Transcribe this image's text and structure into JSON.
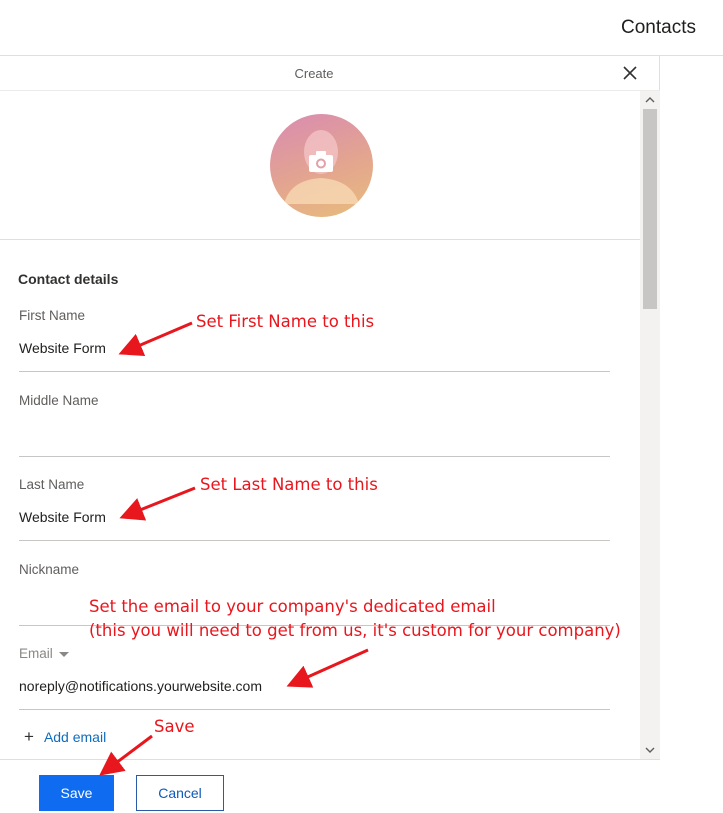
{
  "app": {
    "title": "Contacts"
  },
  "panel": {
    "title": "Create"
  },
  "section": {
    "title": "Contact details"
  },
  "fields": {
    "first_name": {
      "label": "First Name",
      "value": "Website Form"
    },
    "middle_name": {
      "label": "Middle Name",
      "value": ""
    },
    "last_name": {
      "label": "Last Name",
      "value": "Website Form"
    },
    "nickname": {
      "label": "Nickname",
      "value": ""
    },
    "email": {
      "label": "Email",
      "value": "noreply@notifications.yourwebsite.com"
    }
  },
  "add_email": {
    "label": "Add email",
    "icon": "plus-icon"
  },
  "footer": {
    "save_label": "Save",
    "cancel_label": "Cancel"
  },
  "annotations": {
    "first_name": "Set First Name to this",
    "last_name": "Set Last Name to this",
    "email_line1": "Set the email to your company's dedicated email",
    "email_line2": "(this you will need to get from us, it's custom for your company)",
    "save": "Save"
  },
  "colors": {
    "accent": "#0f6cf0",
    "link": "#0f6cbd",
    "annotation": "#e8161d"
  }
}
